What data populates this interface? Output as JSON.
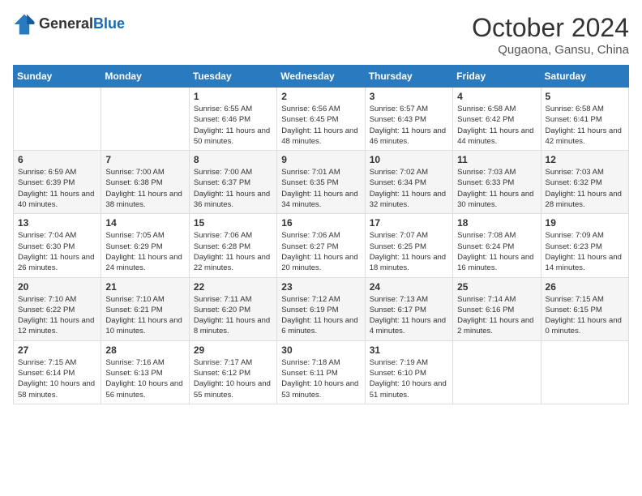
{
  "header": {
    "logo_general": "General",
    "logo_blue": "Blue",
    "month": "October 2024",
    "location": "Qugaona, Gansu, China"
  },
  "weekdays": [
    "Sunday",
    "Monday",
    "Tuesday",
    "Wednesday",
    "Thursday",
    "Friday",
    "Saturday"
  ],
  "weeks": [
    [
      {
        "day": "",
        "info": ""
      },
      {
        "day": "",
        "info": ""
      },
      {
        "day": "1",
        "info": "Sunrise: 6:55 AM\nSunset: 6:46 PM\nDaylight: 11 hours and 50 minutes."
      },
      {
        "day": "2",
        "info": "Sunrise: 6:56 AM\nSunset: 6:45 PM\nDaylight: 11 hours and 48 minutes."
      },
      {
        "day": "3",
        "info": "Sunrise: 6:57 AM\nSunset: 6:43 PM\nDaylight: 11 hours and 46 minutes."
      },
      {
        "day": "4",
        "info": "Sunrise: 6:58 AM\nSunset: 6:42 PM\nDaylight: 11 hours and 44 minutes."
      },
      {
        "day": "5",
        "info": "Sunrise: 6:58 AM\nSunset: 6:41 PM\nDaylight: 11 hours and 42 minutes."
      }
    ],
    [
      {
        "day": "6",
        "info": "Sunrise: 6:59 AM\nSunset: 6:39 PM\nDaylight: 11 hours and 40 minutes."
      },
      {
        "day": "7",
        "info": "Sunrise: 7:00 AM\nSunset: 6:38 PM\nDaylight: 11 hours and 38 minutes."
      },
      {
        "day": "8",
        "info": "Sunrise: 7:00 AM\nSunset: 6:37 PM\nDaylight: 11 hours and 36 minutes."
      },
      {
        "day": "9",
        "info": "Sunrise: 7:01 AM\nSunset: 6:35 PM\nDaylight: 11 hours and 34 minutes."
      },
      {
        "day": "10",
        "info": "Sunrise: 7:02 AM\nSunset: 6:34 PM\nDaylight: 11 hours and 32 minutes."
      },
      {
        "day": "11",
        "info": "Sunrise: 7:03 AM\nSunset: 6:33 PM\nDaylight: 11 hours and 30 minutes."
      },
      {
        "day": "12",
        "info": "Sunrise: 7:03 AM\nSunset: 6:32 PM\nDaylight: 11 hours and 28 minutes."
      }
    ],
    [
      {
        "day": "13",
        "info": "Sunrise: 7:04 AM\nSunset: 6:30 PM\nDaylight: 11 hours and 26 minutes."
      },
      {
        "day": "14",
        "info": "Sunrise: 7:05 AM\nSunset: 6:29 PM\nDaylight: 11 hours and 24 minutes."
      },
      {
        "day": "15",
        "info": "Sunrise: 7:06 AM\nSunset: 6:28 PM\nDaylight: 11 hours and 22 minutes."
      },
      {
        "day": "16",
        "info": "Sunrise: 7:06 AM\nSunset: 6:27 PM\nDaylight: 11 hours and 20 minutes."
      },
      {
        "day": "17",
        "info": "Sunrise: 7:07 AM\nSunset: 6:25 PM\nDaylight: 11 hours and 18 minutes."
      },
      {
        "day": "18",
        "info": "Sunrise: 7:08 AM\nSunset: 6:24 PM\nDaylight: 11 hours and 16 minutes."
      },
      {
        "day": "19",
        "info": "Sunrise: 7:09 AM\nSunset: 6:23 PM\nDaylight: 11 hours and 14 minutes."
      }
    ],
    [
      {
        "day": "20",
        "info": "Sunrise: 7:10 AM\nSunset: 6:22 PM\nDaylight: 11 hours and 12 minutes."
      },
      {
        "day": "21",
        "info": "Sunrise: 7:10 AM\nSunset: 6:21 PM\nDaylight: 11 hours and 10 minutes."
      },
      {
        "day": "22",
        "info": "Sunrise: 7:11 AM\nSunset: 6:20 PM\nDaylight: 11 hours and 8 minutes."
      },
      {
        "day": "23",
        "info": "Sunrise: 7:12 AM\nSunset: 6:19 PM\nDaylight: 11 hours and 6 minutes."
      },
      {
        "day": "24",
        "info": "Sunrise: 7:13 AM\nSunset: 6:17 PM\nDaylight: 11 hours and 4 minutes."
      },
      {
        "day": "25",
        "info": "Sunrise: 7:14 AM\nSunset: 6:16 PM\nDaylight: 11 hours and 2 minutes."
      },
      {
        "day": "26",
        "info": "Sunrise: 7:15 AM\nSunset: 6:15 PM\nDaylight: 11 hours and 0 minutes."
      }
    ],
    [
      {
        "day": "27",
        "info": "Sunrise: 7:15 AM\nSunset: 6:14 PM\nDaylight: 10 hours and 58 minutes."
      },
      {
        "day": "28",
        "info": "Sunrise: 7:16 AM\nSunset: 6:13 PM\nDaylight: 10 hours and 56 minutes."
      },
      {
        "day": "29",
        "info": "Sunrise: 7:17 AM\nSunset: 6:12 PM\nDaylight: 10 hours and 55 minutes."
      },
      {
        "day": "30",
        "info": "Sunrise: 7:18 AM\nSunset: 6:11 PM\nDaylight: 10 hours and 53 minutes."
      },
      {
        "day": "31",
        "info": "Sunrise: 7:19 AM\nSunset: 6:10 PM\nDaylight: 10 hours and 51 minutes."
      },
      {
        "day": "",
        "info": ""
      },
      {
        "day": "",
        "info": ""
      }
    ]
  ]
}
